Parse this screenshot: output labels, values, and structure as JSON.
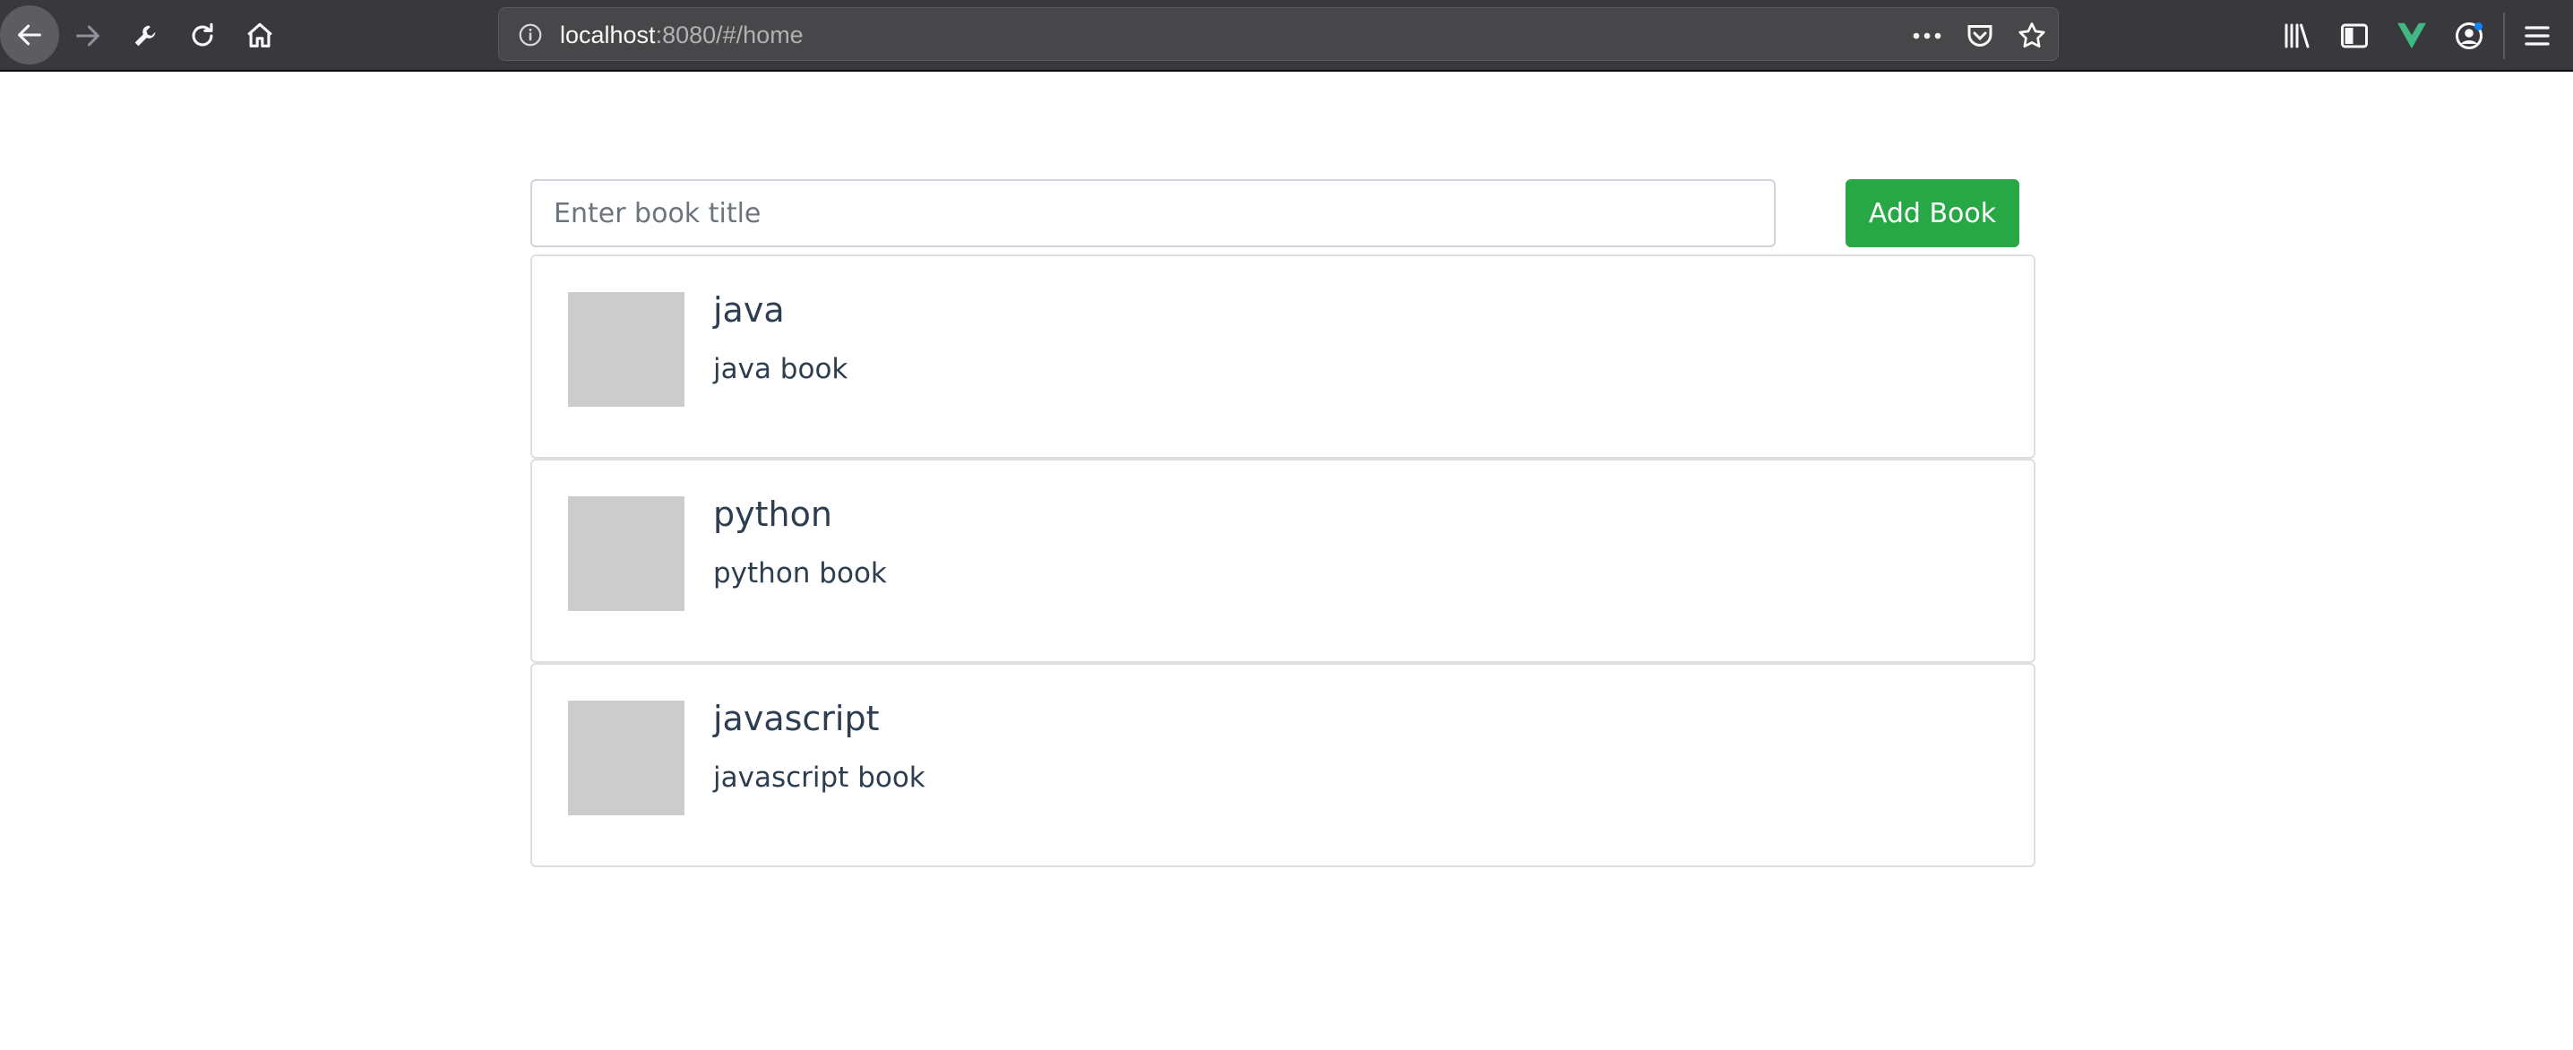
{
  "browser": {
    "url_host": "localhost",
    "url_rest": ":8080/#/home",
    "icons": {
      "back": "back-arrow-icon",
      "forward": "forward-arrow-icon",
      "tools": "wrench-icon",
      "reload": "reload-icon",
      "home": "home-icon",
      "info": "info-icon",
      "more": "more-dots-icon",
      "pocket": "pocket-icon",
      "bookmark": "star-icon",
      "library": "library-icon",
      "sidebar": "sidebar-icon",
      "vue": "vue-devtools-icon",
      "account": "account-icon",
      "menu": "hamburger-menu-icon"
    }
  },
  "form": {
    "placeholder": "Enter book title",
    "value": "",
    "add_label": "Add Book"
  },
  "books": [
    {
      "title": "java",
      "description": "java book"
    },
    {
      "title": "python",
      "description": "python book"
    },
    {
      "title": "javascript",
      "description": "javascript book"
    }
  ],
  "colors": {
    "toolbar_bg": "#38383d",
    "add_button": "#28a745",
    "text": "#2c3e50",
    "thumb": "#cccccc",
    "vue_green": "#41b883"
  }
}
